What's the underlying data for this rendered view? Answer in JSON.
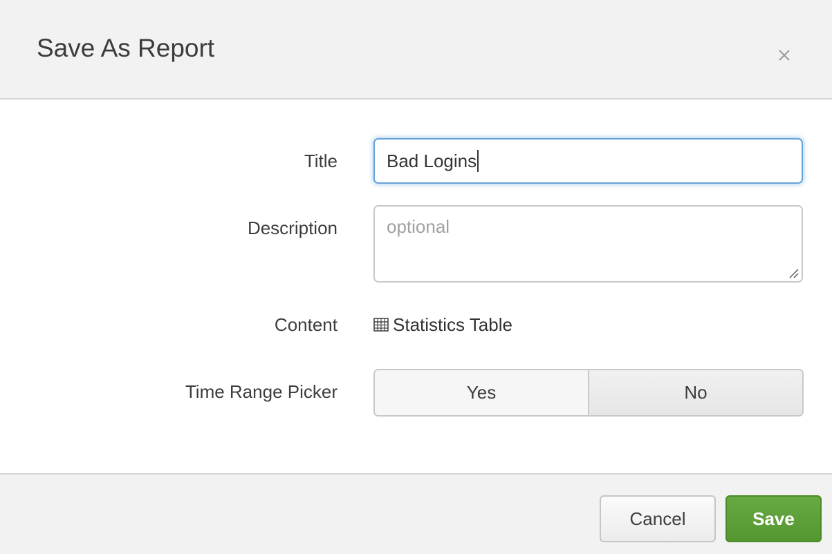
{
  "dialog": {
    "title": "Save As Report",
    "close_icon": "close-icon"
  },
  "form": {
    "title_label": "Title",
    "title_value": "Bad Logins",
    "description_label": "Description",
    "description_placeholder": "optional",
    "content_label": "Content",
    "content_icon": "table-icon",
    "content_value": "Statistics Table",
    "time_range_label": "Time Range Picker",
    "time_range_options": [
      "Yes",
      "No"
    ],
    "time_range_selected": "No"
  },
  "footer": {
    "cancel_label": "Cancel",
    "save_label": "Save"
  },
  "colors": {
    "save_green": "#5a9e36",
    "focus_blue": "#6aa2d8",
    "header_bg": "#f2f2f2"
  }
}
